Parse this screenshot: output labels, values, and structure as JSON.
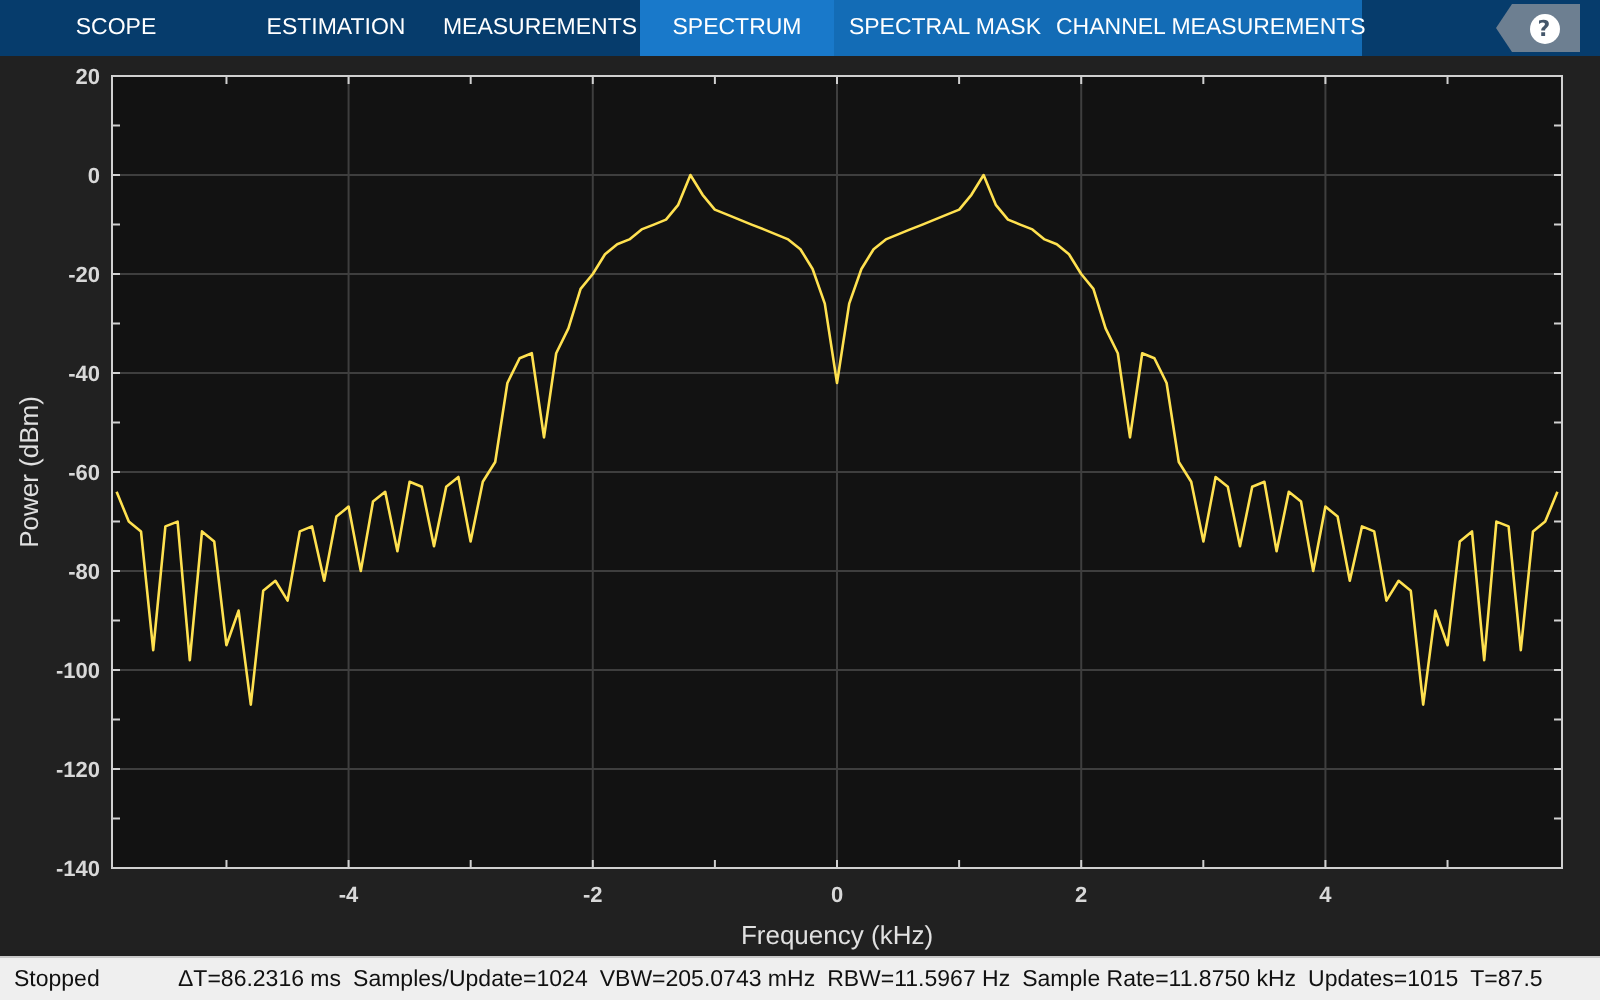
{
  "tabs": [
    {
      "label": "SCOPE",
      "selected": false,
      "contextual": false
    },
    {
      "label": "ESTIMATION",
      "selected": false,
      "contextual": false
    },
    {
      "label": "MEASUREMENTS",
      "selected": false,
      "contextual": false
    },
    {
      "label": "SPECTRUM",
      "selected": true,
      "contextual": true
    },
    {
      "label": "SPECTRAL MASK",
      "selected": false,
      "contextual": true
    },
    {
      "label": "CHANNEL MEASUREMENTS",
      "selected": false,
      "contextual": true
    }
  ],
  "help": "?",
  "plot": {
    "chart_data": {
      "type": "line",
      "grid": true,
      "xlabel": "Frequency (kHz)",
      "ylabel": "Power (dBm)",
      "xlim": [
        -5.9375,
        5.9375
      ],
      "ylim": [
        -140,
        20
      ],
      "xticks": [
        -4,
        -2,
        0,
        2,
        4
      ],
      "yticks": [
        -140,
        -120,
        -100,
        -80,
        -60,
        -40,
        -20,
        0,
        20
      ],
      "x": [
        -5.9,
        -5.8,
        -5.7,
        -5.6,
        -5.5,
        -5.4,
        -5.3,
        -5.2,
        -5.1,
        -5.0,
        -4.9,
        -4.8,
        -4.7,
        -4.6,
        -4.5,
        -4.4,
        -4.3,
        -4.2,
        -4.1,
        -4.0,
        -3.9,
        -3.8,
        -3.7,
        -3.6,
        -3.5,
        -3.4,
        -3.3,
        -3.2,
        -3.1,
        -3.0,
        -2.9,
        -2.8,
        -2.7,
        -2.6,
        -2.5,
        -2.4,
        -2.3,
        -2.2,
        -2.1,
        -2.0,
        -1.9,
        -1.8,
        -1.7,
        -1.6,
        -1.5,
        -1.4,
        -1.3,
        -1.2,
        -1.1,
        -1.0,
        -0.9,
        -0.8,
        -0.7,
        -0.6,
        -0.5,
        -0.4,
        -0.3,
        -0.2,
        -0.1,
        0,
        0.1,
        0.2,
        0.3,
        0.4,
        0.5,
        0.6,
        0.7,
        0.8,
        0.9,
        1.0,
        1.1,
        1.2,
        1.3,
        1.4,
        1.5,
        1.6,
        1.7,
        1.8,
        1.9,
        2.0,
        2.1,
        2.2,
        2.3,
        2.4,
        2.5,
        2.6,
        2.7,
        2.8,
        2.9,
        3.0,
        3.1,
        3.2,
        3.3,
        3.4,
        3.5,
        3.6,
        3.7,
        3.8,
        3.9,
        4.0,
        4.1,
        4.2,
        4.3,
        4.4,
        4.5,
        4.6,
        4.7,
        4.8,
        4.9,
        5.0,
        5.1,
        5.2,
        5.3,
        5.4,
        5.5,
        5.6,
        5.7,
        5.8,
        5.9
      ],
      "series": [
        {
          "color": "#ffe150",
          "values": [
            -64,
            -70,
            -72,
            -96,
            -71,
            -70,
            -98,
            -72,
            -74,
            -95,
            -88,
            -107,
            -84,
            -82,
            -86,
            -72,
            -71,
            -82,
            -69,
            -67,
            -80,
            -66,
            -64,
            -76,
            -62,
            -63,
            -75,
            -63,
            -61,
            -74,
            -62,
            -58,
            -42,
            -37,
            -36,
            -53,
            -36,
            -31,
            -23,
            -20,
            -16,
            -14,
            -13,
            -11,
            -10,
            -9,
            -6,
            0,
            -4,
            -7,
            -8,
            -9,
            -10,
            -11,
            -12,
            -13,
            -15,
            -19,
            -26,
            -42,
            -26,
            -19,
            -15,
            -13,
            -12,
            -11,
            -10,
            -9,
            -8,
            -7,
            -4,
            0,
            -6,
            -9,
            -10,
            -11,
            -13,
            -14,
            -16,
            -20,
            -23,
            -31,
            -36,
            -53,
            -36,
            -37,
            -42,
            -58,
            -62,
            -74,
            -61,
            -63,
            -75,
            -63,
            -62,
            -76,
            -64,
            -66,
            -80,
            -67,
            -69,
            -82,
            -71,
            -72,
            -86,
            -82,
            -84,
            -107,
            -88,
            -95,
            -74,
            -72,
            -98,
            -70,
            -71,
            -96,
            -72,
            -70,
            -64
          ]
        }
      ]
    }
  },
  "status_bar": {
    "state": "Stopped",
    "readings": [
      "ΔT=86.2316 ms",
      "Samples/Update=1024",
      "VBW=205.0743 mHz",
      "RBW=11.5967 Hz",
      "Sample Rate=11.8750 kHz",
      "Updates=1015",
      "T=87.5"
    ]
  }
}
